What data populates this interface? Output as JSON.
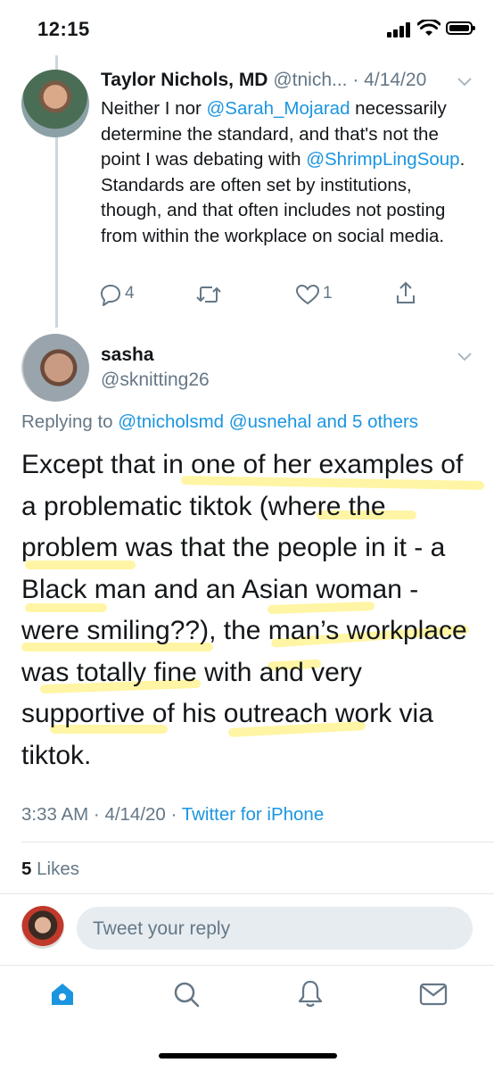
{
  "status_bar": {
    "time": "12:15"
  },
  "tweet1": {
    "author_name": "Taylor Nichols, MD",
    "handle": "@tnich...",
    "date": "· 4/14/20",
    "body_parts": [
      {
        "text": "Neither I nor ",
        "link": false
      },
      {
        "text": "@Sarah_Mojarad",
        "link": true
      },
      {
        "text": " necessarily determine the standard, and that's not the point I was debating with ",
        "link": false
      },
      {
        "text": "@ShrimpLingSoup",
        "link": true
      },
      {
        "text": ". Standards are often set by institutions, though, and that often includes not posting from within the workplace on social media.",
        "link": false
      }
    ],
    "replies_count": "4",
    "likes_count": "1"
  },
  "tweet2": {
    "author_name": "sasha",
    "handle": "@sknitting26",
    "replying_prefix": "Replying to ",
    "replying_to": "@tnicholsmd @usnehal and 5 others",
    "text": "Except that in one of her examples of a problematic tiktok (where the problem was that the people in it - a Black man and an Asian woman - were smiling??), the man’s workplace was totally fine with and very supportive of his outreach work via tiktok.",
    "time": "3:33 AM",
    "date": "4/14/20",
    "source": "Twitter for iPhone",
    "likes_count": "5",
    "likes_label": "Likes"
  },
  "reply": {
    "placeholder": "Tweet your reply"
  },
  "tabs": [
    "home-icon",
    "search-icon",
    "notifications-icon",
    "messages-icon"
  ],
  "colors": {
    "accent": "#1b95e0",
    "muted": "#657786",
    "highlight": "#ffec5a"
  }
}
